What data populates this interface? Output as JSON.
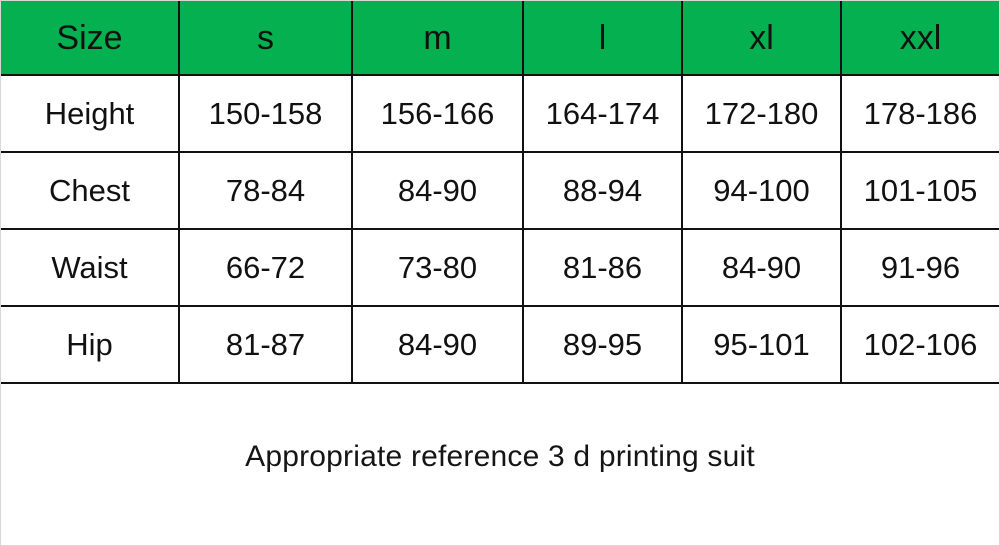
{
  "table": {
    "columns": [
      "Size",
      "s",
      "m",
      "l",
      "xl",
      "xxl"
    ],
    "header_bg": "#05b050",
    "header_text_color": "#111111",
    "body_bg": "#ffffff",
    "border_color": "#111111",
    "rows": [
      {
        "label": "Height",
        "values": [
          "150-158",
          "156-166",
          "164-174",
          "172-180",
          "178-186"
        ]
      },
      {
        "label": "Chest",
        "values": [
          "78-84",
          "84-90",
          "88-94",
          "94-100",
          "101-105"
        ]
      },
      {
        "label": "Waist",
        "values": [
          "66-72",
          "73-80",
          "81-86",
          "84-90",
          "91-96"
        ]
      },
      {
        "label": "Hip",
        "values": [
          "81-87",
          "84-90",
          "89-95",
          "95-101",
          "102-106"
        ]
      }
    ]
  },
  "footer": {
    "note": "Appropriate reference 3 d printing suit"
  }
}
